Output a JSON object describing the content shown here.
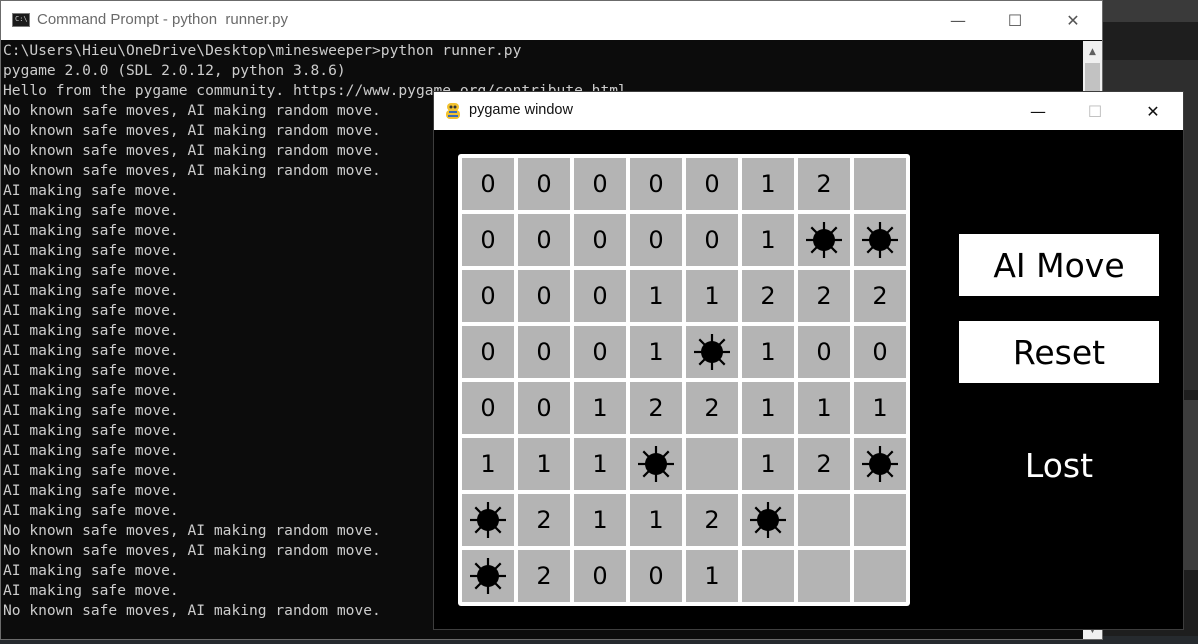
{
  "cmd": {
    "title": "Command Prompt - python  runner.py",
    "controls": {
      "minimize": "—",
      "maximize": "☐",
      "close": "✕"
    },
    "lines": [
      "C:\\Users\\Hieu\\OneDrive\\Desktop\\minesweeper>python runner.py",
      "pygame 2.0.0 (SDL 2.0.12, python 3.8.6)",
      "Hello from the pygame community. https://www.pygame.org/contribute.html",
      "No known safe moves, AI making random move.",
      "No known safe moves, AI making random move.",
      "No known safe moves, AI making random move.",
      "No known safe moves, AI making random move.",
      "AI making safe move.",
      "AI making safe move.",
      "AI making safe move.",
      "AI making safe move.",
      "AI making safe move.",
      "AI making safe move.",
      "AI making safe move.",
      "AI making safe move.",
      "AI making safe move.",
      "AI making safe move.",
      "AI making safe move.",
      "AI making safe move.",
      "AI making safe move.",
      "AI making safe move.",
      "AI making safe move.",
      "AI making safe move.",
      "AI making safe move.",
      "No known safe moves, AI making random move.",
      "No known safe moves, AI making random move.",
      "AI making safe move.",
      "AI making safe move.",
      "No known safe moves, AI making random move."
    ]
  },
  "pygame": {
    "title": "pygame window",
    "controls": {
      "minimize": "—",
      "maximize": "☐",
      "close": "✕"
    },
    "board": [
      [
        "0",
        "0",
        "0",
        "0",
        "0",
        "1",
        "2",
        ""
      ],
      [
        "0",
        "0",
        "0",
        "0",
        "0",
        "1",
        "*",
        "*"
      ],
      [
        "0",
        "0",
        "0",
        "1",
        "1",
        "2",
        "2",
        "2"
      ],
      [
        "0",
        "0",
        "0",
        "1",
        "*",
        "1",
        "0",
        "0"
      ],
      [
        "0",
        "0",
        "1",
        "2",
        "2",
        "1",
        "1",
        "1"
      ],
      [
        "1",
        "1",
        "1",
        "*",
        "",
        "1",
        "2",
        "*"
      ],
      [
        "*",
        "2",
        "1",
        "1",
        "2",
        "*",
        "",
        ""
      ],
      [
        "*",
        "2",
        "0",
        "0",
        "1",
        "",
        "",
        ""
      ]
    ],
    "ai_move_label": "AI Move",
    "reset_label": "Reset",
    "status": "Lost"
  },
  "colors": {
    "cell": "#b4b4b4",
    "board_border": "#ffffff",
    "terminal_bg": "#0c0c0c",
    "terminal_text": "#cccccc"
  },
  "icons": {
    "mine": "mine-icon",
    "cmd": "cmd-icon",
    "pygame": "pygame-snake-icon"
  }
}
